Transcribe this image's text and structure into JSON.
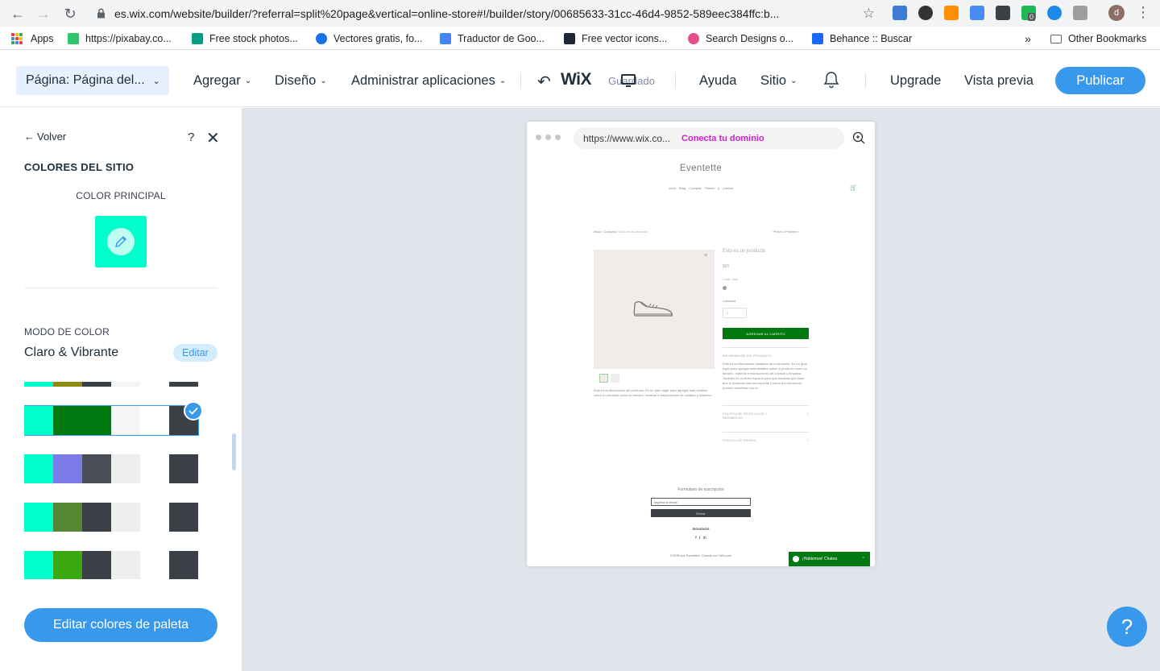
{
  "browser": {
    "url": "es.wix.com/website/builder/?referral=split%20page&vertical=online-store#!/builder/story/00685633-31cc-46d4-9852-589eec384ffc:b...",
    "profile_initial": "d",
    "extension_badge": "0"
  },
  "bookmarks": {
    "items": [
      {
        "label": "Apps"
      },
      {
        "label": "https://pixabay.co..."
      },
      {
        "label": "Free stock photos..."
      },
      {
        "label": "Vectores gratis, fo..."
      },
      {
        "label": "Traductor de Goo..."
      },
      {
        "label": "Free vector icons..."
      },
      {
        "label": "Search Designs o..."
      },
      {
        "label": "Behance :: Buscar"
      }
    ],
    "overflow": "»",
    "other": "Other Bookmarks"
  },
  "wix_bar": {
    "page_selector": "Página: Página del...",
    "menu": {
      "add": "Agregar",
      "design": "Diseño",
      "apps": "Administrar aplicaciones"
    },
    "logo": "WiX",
    "saved_status": "Guardado",
    "help": "Ayuda",
    "site": "Sitio",
    "upgrade": "Upgrade",
    "preview": "Vista previa",
    "publish": "Publicar"
  },
  "panel": {
    "back": "Volver",
    "help": "?",
    "title": "COLORES DEL SITIO",
    "main_color_label": "COLOR PRINCIPAL",
    "main_color": "#00ffcc",
    "mode_label": "MODO DE COLOR",
    "mode_value": "Claro & Vibrante",
    "edit": "Editar",
    "palettes": [
      {
        "colors": [
          "#00ffcc",
          "#8e8a0c",
          "#3b3f46",
          "#f4f4f4",
          "#ffffff",
          "#3b3f46"
        ],
        "selected": false
      },
      {
        "colors": [
          "#00ffcc",
          "#007a10",
          "#007a10",
          "#f4f5f5",
          "#ffffff",
          "#3b3f46"
        ],
        "selected": true
      },
      {
        "colors": [
          "#00ffcc",
          "#7b7be8",
          "#4a4f57",
          "#eeeeee",
          "#ffffff",
          "#3b3f46"
        ],
        "selected": false
      },
      {
        "colors": [
          "#00ffcc",
          "#568733",
          "#3b3f46",
          "#eeeeee",
          "#ffffff",
          "#3b3f46"
        ],
        "selected": false
      },
      {
        "colors": [
          "#00ffcc",
          "#3aa80f",
          "#3b3f46",
          "#eeeeee",
          "#ffffff",
          "#3b3f46"
        ],
        "selected": false
      }
    ],
    "edit_palette_button": "Editar colores de paleta"
  },
  "preview": {
    "url": "https://www.wix.co...",
    "connect_domain": "Conecta tu dominio",
    "site_name": "Eventette",
    "nav": "Inicio  Blog  Comprar  Planes y precios",
    "breadcrumb_path": "Inicio / Comprar /",
    "breadcrumb_current": "Esto es un producto",
    "prev_next": "‹ Previo  |  Próximo ›",
    "product_title": "Esto es un producto",
    "price": "$85",
    "color_label": "Color: Gris",
    "quantity_label": "Cantidad",
    "quantity_value": "1",
    "add_to_cart": "AGREGAR AL CARRITO",
    "description": "Esta es la descripción del producto. Es un gran lugar para agregar más detalles sobre tu producto como su tamaño, material e instrucciones de cuidado y limpieza.",
    "info_header": "INFORMACIÓN DEL PRODUCTO",
    "info_body": "Esta es la información detallada de tu producto. Es un gran lugar para agregar más detalles sobre tu producto como su tamaño, material e instrucciones de cuidado y limpieza. También es un buen espacio para que escribas qué hace que tu producto sea tan especial y cómo tus clientes se pueden beneficiar con él.",
    "returns_header": "POLÍTICA DE DEVOLUCIÓN Y REEMBOLSO",
    "shipping_header": "POLÍTICA DE ENVÍOS",
    "subscribe_title": "Formulario de suscripción",
    "subscribe_placeholder": "Ingresa tu email",
    "subscribe_button": "Enviar",
    "follow": "SÍGUENOS",
    "socials": "f  t  in",
    "copyright": "©2035 por Eventette. Creado con Wix.com",
    "chat": "¡Hablemos! Chatea",
    "accent": "#007a10"
  },
  "help_fab": "?"
}
